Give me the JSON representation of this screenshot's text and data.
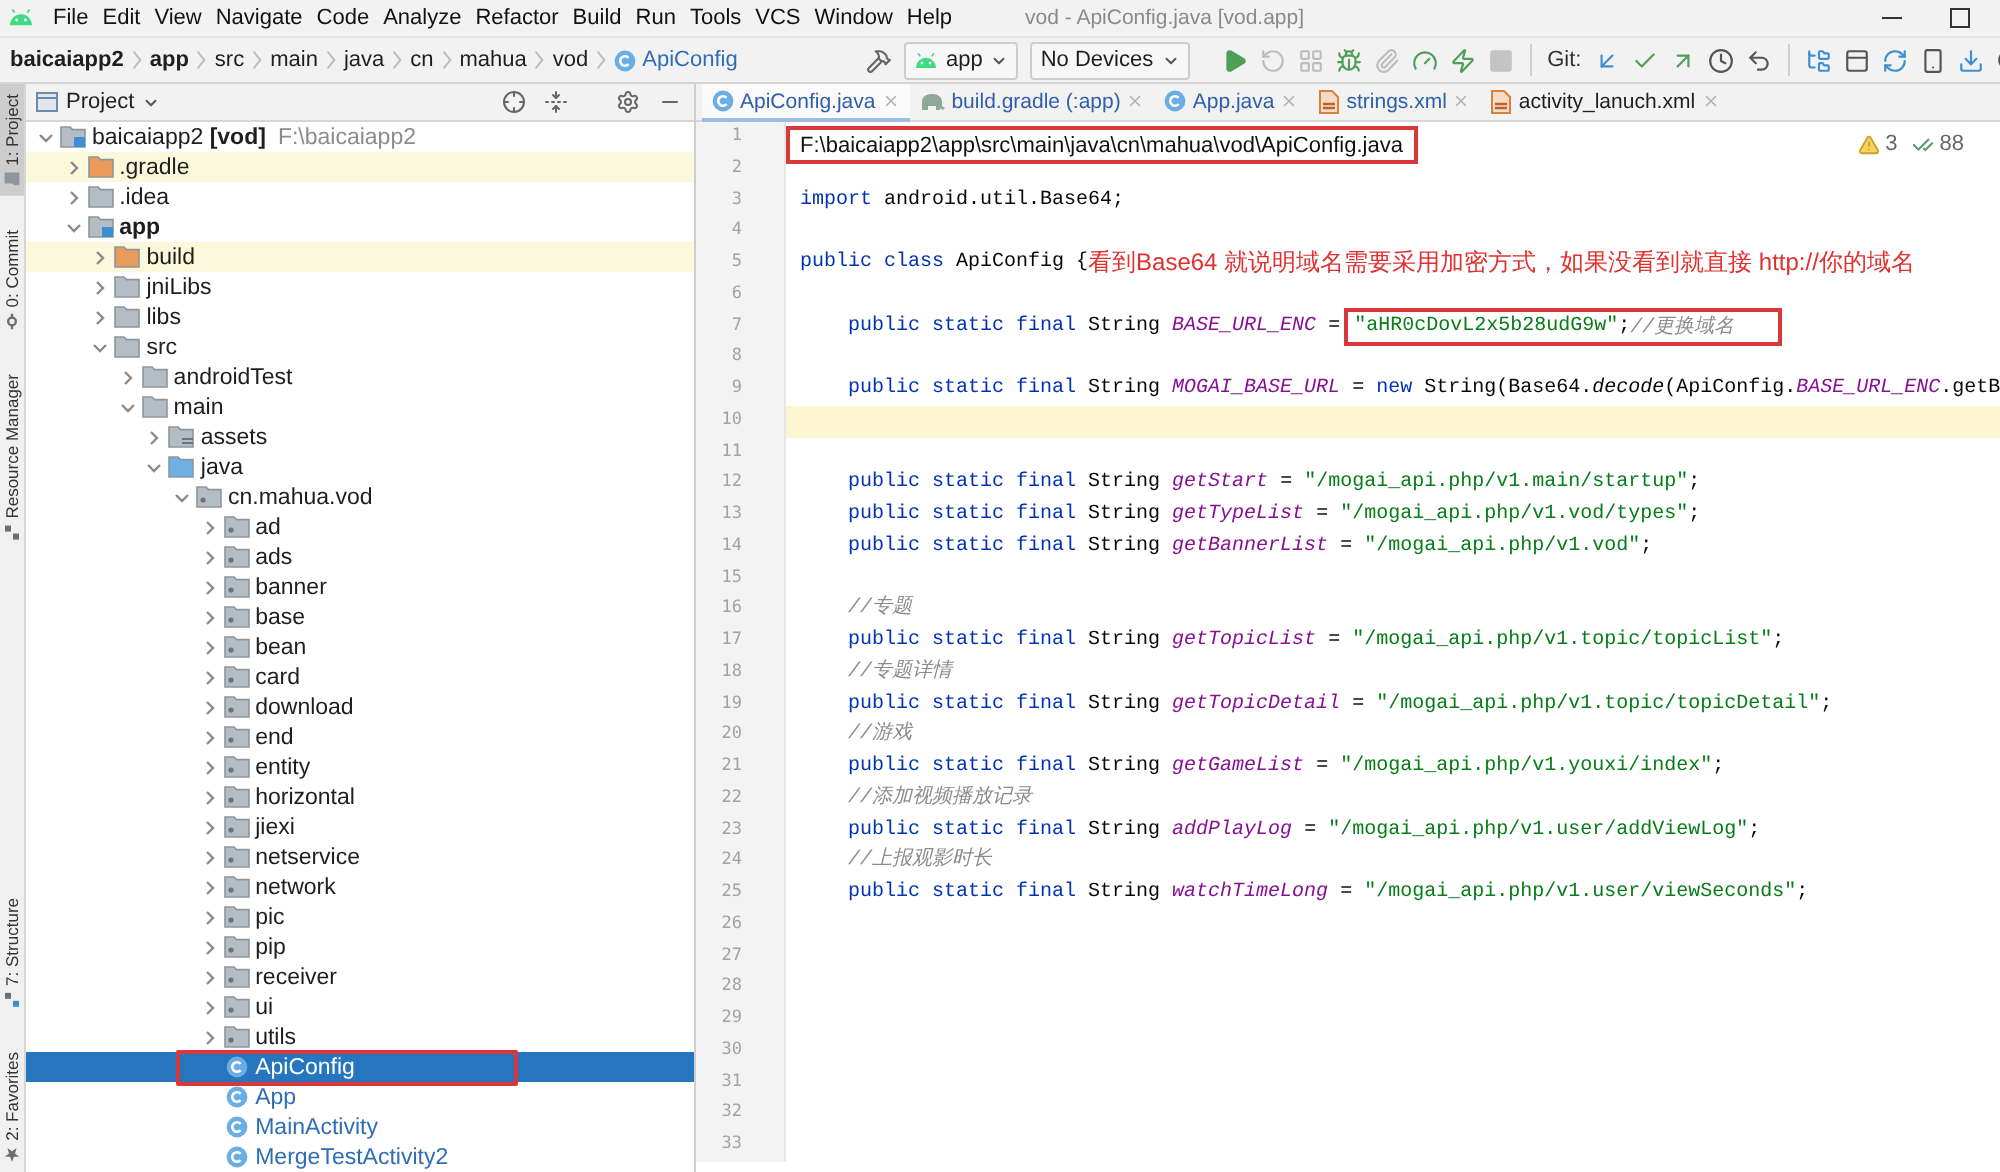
{
  "menu_bar": {
    "items": [
      "File",
      "Edit",
      "View",
      "Navigate",
      "Code",
      "Analyze",
      "Refactor",
      "Build",
      "Run",
      "Tools",
      "VCS",
      "Window",
      "Help"
    ],
    "window_title": "vod - ApiConfig.java [vod.app]"
  },
  "navigation_bar": {
    "breadcrumbs": [
      {
        "label": "baicaiapp2",
        "kind": "project"
      },
      {
        "label": "app",
        "kind": "module"
      },
      {
        "label": "src",
        "kind": "folder"
      },
      {
        "label": "main",
        "kind": "folder"
      },
      {
        "label": "java",
        "kind": "folder"
      },
      {
        "label": "cn",
        "kind": "folder"
      },
      {
        "label": "mahua",
        "kind": "folder"
      },
      {
        "label": "vod",
        "kind": "folder"
      },
      {
        "label": "ApiConfig",
        "kind": "class"
      }
    ],
    "run_config": "app",
    "device": "No Devices",
    "vcs_label": "Git:"
  },
  "tool_stripe": {
    "top": [
      {
        "label": "1: Project",
        "kind": "project",
        "selected": true
      },
      {
        "label": "0: Commit",
        "kind": "commit",
        "selected": false
      },
      {
        "label": "Resource Manager",
        "kind": "resources",
        "selected": false
      }
    ],
    "bottom": [
      {
        "label": "7: Structure",
        "kind": "structure",
        "selected": false
      },
      {
        "label": "2: Favorites",
        "kind": "favorites",
        "selected": false
      }
    ]
  },
  "project_panel": {
    "title": "Project",
    "tree": [
      {
        "label": "baicaiapp2 **[vod]**",
        "path": "F:\\baicaiapp2",
        "kind": "project",
        "selected": false,
        "boxed": false,
        "expanded": true,
        "children": [
          {
            "label": ".gradle",
            "kind": "excluded",
            "selected": false,
            "boxed": false,
            "expanded": false
          },
          {
            "label": ".idea",
            "kind": "folder",
            "selected": false,
            "boxed": false,
            "expanded": false
          },
          {
            "label": "app",
            "kind": "module",
            "selected": false,
            "boxed": false,
            "expanded": true,
            "children": [
              {
                "label": "build",
                "kind": "excluded",
                "selected": false,
                "boxed": false,
                "expanded": false
              },
              {
                "label": "jniLibs",
                "kind": "folder",
                "selected": false,
                "boxed": false,
                "expanded": false
              },
              {
                "label": "libs",
                "kind": "folder",
                "selected": false,
                "boxed": false,
                "expanded": false
              },
              {
                "label": "src",
                "kind": "folder",
                "selected": false,
                "boxed": false,
                "expanded": true,
                "children": [
                  {
                    "label": "androidTest",
                    "kind": "folder",
                    "selected": false,
                    "boxed": false,
                    "expanded": false
                  },
                  {
                    "label": "main",
                    "kind": "folder",
                    "selected": false,
                    "boxed": false,
                    "expanded": true,
                    "children": [
                      {
                        "label": "assets",
                        "kind": "resources",
                        "selected": false,
                        "boxed": false,
                        "expanded": false
                      },
                      {
                        "label": "java",
                        "kind": "source",
                        "selected": false,
                        "boxed": false,
                        "expanded": true,
                        "children": [
                          {
                            "label": "cn.mahua.vod",
                            "kind": "package",
                            "selected": false,
                            "boxed": false,
                            "expanded": true,
                            "children": [
                              {
                                "label": "ad",
                                "kind": "package",
                                "selected": false,
                                "boxed": false,
                                "expanded": false
                              },
                              {
                                "label": "ads",
                                "kind": "package",
                                "selected": false,
                                "boxed": false,
                                "expanded": false
                              },
                              {
                                "label": "banner",
                                "kind": "package",
                                "selected": false,
                                "boxed": false,
                                "expanded": false
                              },
                              {
                                "label": "base",
                                "kind": "package",
                                "selected": false,
                                "boxed": false,
                                "expanded": false
                              },
                              {
                                "label": "bean",
                                "kind": "package",
                                "selected": false,
                                "boxed": false,
                                "expanded": false
                              },
                              {
                                "label": "card",
                                "kind": "package",
                                "selected": false,
                                "boxed": false,
                                "expanded": false
                              },
                              {
                                "label": "download",
                                "kind": "package",
                                "selected": false,
                                "boxed": false,
                                "expanded": false
                              },
                              {
                                "label": "end",
                                "kind": "package",
                                "selected": false,
                                "boxed": false,
                                "expanded": false
                              },
                              {
                                "label": "entity",
                                "kind": "package",
                                "selected": false,
                                "boxed": false,
                                "expanded": false
                              },
                              {
                                "label": "horizontal",
                                "kind": "package",
                                "selected": false,
                                "boxed": false,
                                "expanded": false
                              },
                              {
                                "label": "jiexi",
                                "kind": "package",
                                "selected": false,
                                "boxed": false,
                                "expanded": false
                              },
                              {
                                "label": "netservice",
                                "kind": "package",
                                "selected": false,
                                "boxed": false,
                                "expanded": false
                              },
                              {
                                "label": "network",
                                "kind": "package",
                                "selected": false,
                                "boxed": false,
                                "expanded": false
                              },
                              {
                                "label": "pic",
                                "kind": "package",
                                "selected": false,
                                "boxed": false,
                                "expanded": false
                              },
                              {
                                "label": "pip",
                                "kind": "package",
                                "selected": false,
                                "boxed": false,
                                "expanded": false
                              },
                              {
                                "label": "receiver",
                                "kind": "package",
                                "selected": false,
                                "boxed": false,
                                "expanded": false
                              },
                              {
                                "label": "ui",
                                "kind": "package",
                                "selected": false,
                                "boxed": false,
                                "expanded": false
                              },
                              {
                                "label": "utils",
                                "kind": "package",
                                "selected": false,
                                "boxed": false,
                                "expanded": false
                              },
                              {
                                "label": "ApiConfig",
                                "kind": "class",
                                "selected": true,
                                "boxed": true
                              },
                              {
                                "label": "App",
                                "kind": "class",
                                "selected": false,
                                "boxed": false
                              },
                              {
                                "label": "MainActivity",
                                "kind": "class",
                                "selected": false,
                                "boxed": false
                              },
                              {
                                "label": "MergeTestActivity2",
                                "kind": "class",
                                "selected": false,
                                "boxed": false
                              }
                            ]
                          }
                        ]
                      }
                    ]
                  }
                ]
              }
            ]
          }
        ]
      }
    ]
  },
  "editor": {
    "tabs": [
      {
        "label": "ApiConfig.java",
        "kind": "class",
        "selected": true,
        "modified": true
      },
      {
        "label": "build.gradle (:app)",
        "kind": "gradle",
        "selected": false,
        "modified": true
      },
      {
        "label": "App.java",
        "kind": "class",
        "selected": false,
        "modified": true
      },
      {
        "label": "strings.xml",
        "kind": "xml",
        "selected": false,
        "modified": true
      },
      {
        "label": "activity_lanuch.xml",
        "kind": "xml",
        "selected": false,
        "modified": false
      }
    ],
    "inspections": {
      "warnings": "3",
      "weak_warnings": "88"
    },
    "lines": [
      {
        "number": "1",
        "kind": "top",
        "current": false,
        "boxed": [
          {
            "kind": "path",
            "text": "F:\\baicaiapp2\\app\\src\\main\\java\\cn\\mahua\\vod\\ApiConfig.java"
          }
        ]
      },
      {
        "number": "2",
        "kind": "blank",
        "current": false
      },
      {
        "number": "3",
        "kind": "top",
        "current": false,
        "code": [
          {
            "kind": "keyword",
            "text": "import"
          },
          {
            "kind": "plain",
            "text": " android.util.Base64;"
          }
        ]
      },
      {
        "number": "4",
        "kind": "blank",
        "current": false
      },
      {
        "number": "5",
        "kind": "top",
        "current": false,
        "code": [
          {
            "kind": "keyword",
            "text": "public class"
          },
          {
            "kind": "plain",
            "text": " ApiConfig {"
          }
        ],
        "note": "看到Base64 就说明域名需要采用加密方式，如果没看到就直接 http://你的域名"
      },
      {
        "number": "6",
        "kind": "blank",
        "current": false
      },
      {
        "number": "7",
        "kind": "member",
        "current": false,
        "code": [
          {
            "kind": "keyword",
            "text": "public static final"
          },
          {
            "kind": "plain",
            "text": " String "
          },
          {
            "kind": "field",
            "text": "BASE_URL_ENC"
          },
          {
            "kind": "plain",
            "text": " = "
          }
        ],
        "boxed": [
          {
            "kind": "string",
            "text": "\"aHR0cDovL2x5b28udG9w\""
          },
          {
            "kind": "plain",
            "text": ";"
          },
          {
            "kind": "comment",
            "text": "//更换域名"
          }
        ]
      },
      {
        "number": "8",
        "kind": "blank",
        "current": false
      },
      {
        "number": "9",
        "kind": "member",
        "current": false,
        "code": [
          {
            "kind": "keyword",
            "text": "public static final"
          },
          {
            "kind": "plain",
            "text": " String "
          },
          {
            "kind": "field",
            "text": "MOGAI_BASE_URL"
          },
          {
            "kind": "plain",
            "text": " = "
          },
          {
            "kind": "keyword",
            "text": "new"
          },
          {
            "kind": "plain",
            "text": " String(Base64."
          },
          {
            "kind": "method",
            "text": "decode"
          },
          {
            "kind": "plain",
            "text": "(ApiConfig."
          },
          {
            "kind": "field",
            "text": "BASE_URL_ENC"
          },
          {
            "kind": "plain",
            "text": ".getB"
          }
        ]
      },
      {
        "number": "10",
        "kind": "blank",
        "current": true
      },
      {
        "number": "11",
        "kind": "blank",
        "current": false
      },
      {
        "number": "12",
        "kind": "member",
        "current": false,
        "code": [
          {
            "kind": "keyword",
            "text": "public static final"
          },
          {
            "kind": "plain",
            "text": " String "
          },
          {
            "kind": "field",
            "text": "getStart"
          },
          {
            "kind": "plain",
            "text": " = "
          },
          {
            "kind": "string",
            "text": "\"/mogai_api.php/v1.main/startup\""
          },
          {
            "kind": "plain",
            "text": ";"
          }
        ]
      },
      {
        "number": "13",
        "kind": "member",
        "current": false,
        "code": [
          {
            "kind": "keyword",
            "text": "public static final"
          },
          {
            "kind": "plain",
            "text": " String "
          },
          {
            "kind": "field",
            "text": "getTypeList"
          },
          {
            "kind": "plain",
            "text": " = "
          },
          {
            "kind": "string",
            "text": "\"/mogai_api.php/v1.vod/types\""
          },
          {
            "kind": "plain",
            "text": ";"
          }
        ]
      },
      {
        "number": "14",
        "kind": "member",
        "current": false,
        "code": [
          {
            "kind": "keyword",
            "text": "public static final"
          },
          {
            "kind": "plain",
            "text": " String "
          },
          {
            "kind": "field",
            "text": "getBannerList"
          },
          {
            "kind": "plain",
            "text": " = "
          },
          {
            "kind": "string",
            "text": "\"/mogai_api.php/v1.vod\""
          },
          {
            "kind": "plain",
            "text": ";"
          }
        ]
      },
      {
        "number": "15",
        "kind": "blank",
        "current": false
      },
      {
        "number": "16",
        "kind": "member",
        "current": false,
        "code": [
          {
            "kind": "comment",
            "text": "//专题"
          }
        ]
      },
      {
        "number": "17",
        "kind": "member",
        "current": false,
        "code": [
          {
            "kind": "keyword",
            "text": "public static final"
          },
          {
            "kind": "plain",
            "text": " String "
          },
          {
            "kind": "field",
            "text": "getTopicList"
          },
          {
            "kind": "plain",
            "text": " = "
          },
          {
            "kind": "string",
            "text": "\"/mogai_api.php/v1.topic/topicList\""
          },
          {
            "kind": "plain",
            "text": ";"
          }
        ]
      },
      {
        "number": "18",
        "kind": "member",
        "current": false,
        "code": [
          {
            "kind": "comment",
            "text": "//专题详情"
          }
        ]
      },
      {
        "number": "19",
        "kind": "member",
        "current": false,
        "code": [
          {
            "kind": "keyword",
            "text": "public static final"
          },
          {
            "kind": "plain",
            "text": " String "
          },
          {
            "kind": "field",
            "text": "getTopicDetail"
          },
          {
            "kind": "plain",
            "text": " = "
          },
          {
            "kind": "string",
            "text": "\"/mogai_api.php/v1.topic/topicDetail\""
          },
          {
            "kind": "plain",
            "text": ";"
          }
        ]
      },
      {
        "number": "20",
        "kind": "member",
        "current": false,
        "code": [
          {
            "kind": "comment",
            "text": "//游戏"
          }
        ]
      },
      {
        "number": "21",
        "kind": "member",
        "current": false,
        "code": [
          {
            "kind": "keyword",
            "text": "public static final"
          },
          {
            "kind": "plain",
            "text": " String "
          },
          {
            "kind": "field",
            "text": "getGameList"
          },
          {
            "kind": "plain",
            "text": " = "
          },
          {
            "kind": "string",
            "text": "\"/mogai_api.php/v1.youxi/index\""
          },
          {
            "kind": "plain",
            "text": ";"
          }
        ]
      },
      {
        "number": "22",
        "kind": "member",
        "current": false,
        "code": [
          {
            "kind": "comment",
            "text": "//添加视频播放记录"
          }
        ]
      },
      {
        "number": "23",
        "kind": "member",
        "current": false,
        "code": [
          {
            "kind": "keyword",
            "text": "public static final"
          },
          {
            "kind": "plain",
            "text": " String "
          },
          {
            "kind": "field",
            "text": "addPlayLog"
          },
          {
            "kind": "plain",
            "text": " = "
          },
          {
            "kind": "string",
            "text": "\"/mogai_api.php/v1.user/addViewLog\""
          },
          {
            "kind": "plain",
            "text": ";"
          }
        ]
      },
      {
        "number": "24",
        "kind": "member",
        "current": false,
        "code": [
          {
            "kind": "comment",
            "text": "//上报观影时长"
          }
        ]
      },
      {
        "number": "25",
        "kind": "member",
        "current": false,
        "code": [
          {
            "kind": "keyword",
            "text": "public static final"
          },
          {
            "kind": "plain",
            "text": " String "
          },
          {
            "kind": "field",
            "text": "watchTimeLong"
          },
          {
            "kind": "plain",
            "text": " = "
          },
          {
            "kind": "string",
            "text": "\"/mogai_api.php/v1.user/viewSeconds\""
          },
          {
            "kind": "plain",
            "text": ";"
          }
        ]
      },
      {
        "number": "26",
        "kind": "blank",
        "current": false
      },
      {
        "number": "27",
        "kind": "blank",
        "current": false
      },
      {
        "number": "28",
        "kind": "blank",
        "current": false
      },
      {
        "number": "29",
        "kind": "blank",
        "current": false
      },
      {
        "number": "30",
        "kind": "blank",
        "current": false
      },
      {
        "number": "31",
        "kind": "blank",
        "current": false
      },
      {
        "number": "32",
        "kind": "blank",
        "current": false
      },
      {
        "number": "33",
        "kind": "blank",
        "current": false
      }
    ]
  }
}
